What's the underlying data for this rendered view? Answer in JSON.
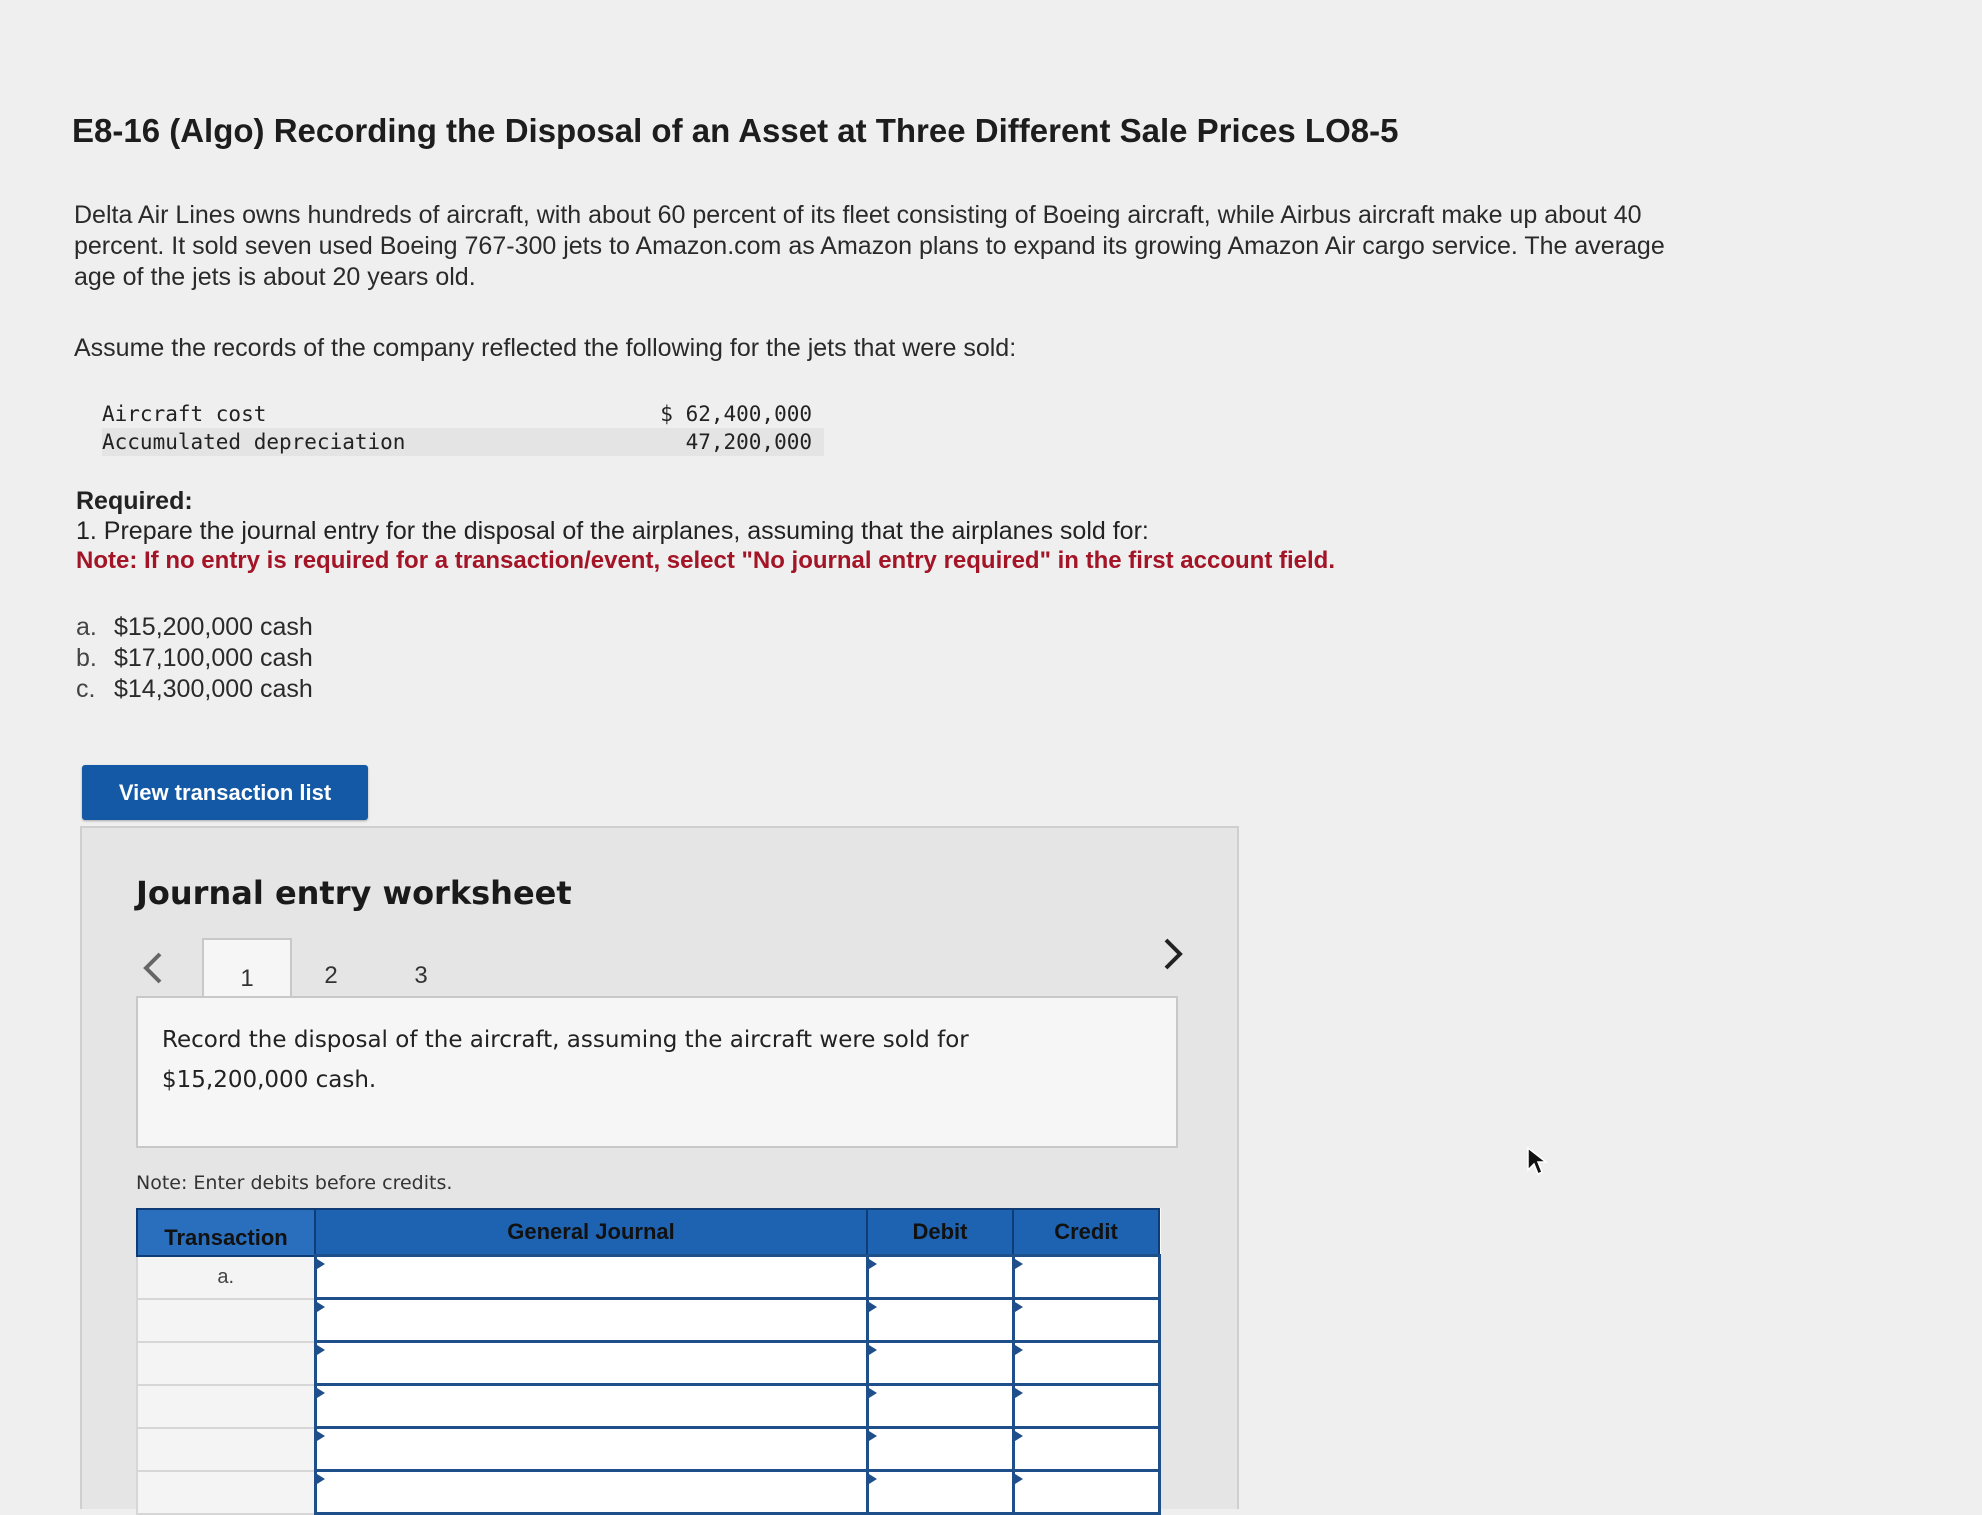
{
  "header": {
    "title": "E8-16 (Algo) Recording the Disposal of an Asset at Three Different Sale Prices LO8-5"
  },
  "intro": {
    "paragraph": "Delta Air Lines owns hundreds of aircraft, with about 60 percent of its fleet consisting of Boeing aircraft, while Airbus aircraft make up about 40 percent. It sold seven used Boeing 767-300 jets to Amazon.com as Amazon plans to expand its growing Amazon Air cargo service. The average age of the jets is about 20 years old.",
    "assume": "Assume the records of the company reflected the following for the jets that were sold:"
  },
  "records": [
    {
      "label": "Aircraft cost",
      "value": "$ 62,400,000"
    },
    {
      "label": "Accumulated depreciation",
      "value": "47,200,000"
    }
  ],
  "required": {
    "heading": "Required:",
    "item": "1. Prepare the journal entry for the disposal of the airplanes, assuming that the airplanes sold for:",
    "note": "Note: If no entry is required for a transaction/event, select \"No journal entry required\" in the first account field."
  },
  "options": [
    {
      "letter": "a.",
      "text": "$15,200,000 cash"
    },
    {
      "letter": "b.",
      "text": "$17,100,000 cash"
    },
    {
      "letter": "c.",
      "text": "$14,300,000 cash"
    }
  ],
  "view_button": "View transaction list",
  "worksheet": {
    "title": "Journal entry worksheet",
    "tabs": [
      "1",
      "2",
      "3"
    ],
    "active_tab": "1",
    "prev_icon": "chevron-left-icon",
    "next_icon": "chevron-right-icon",
    "instruction": "Record the disposal of the aircraft, assuming the aircraft were sold for $15,200,000 cash.",
    "note": "Note: Enter debits before credits.",
    "table": {
      "headers": {
        "transaction": "Transaction",
        "journal": "General Journal",
        "debit": "Debit",
        "credit": "Credit"
      },
      "rows": [
        {
          "transaction": "a."
        },
        {
          "transaction": ""
        },
        {
          "transaction": ""
        },
        {
          "transaction": ""
        },
        {
          "transaction": ""
        },
        {
          "transaction": ""
        }
      ]
    }
  },
  "colors": {
    "accent": "#1459a6",
    "note_red": "#a31426",
    "table_header": "#1e63b1"
  }
}
